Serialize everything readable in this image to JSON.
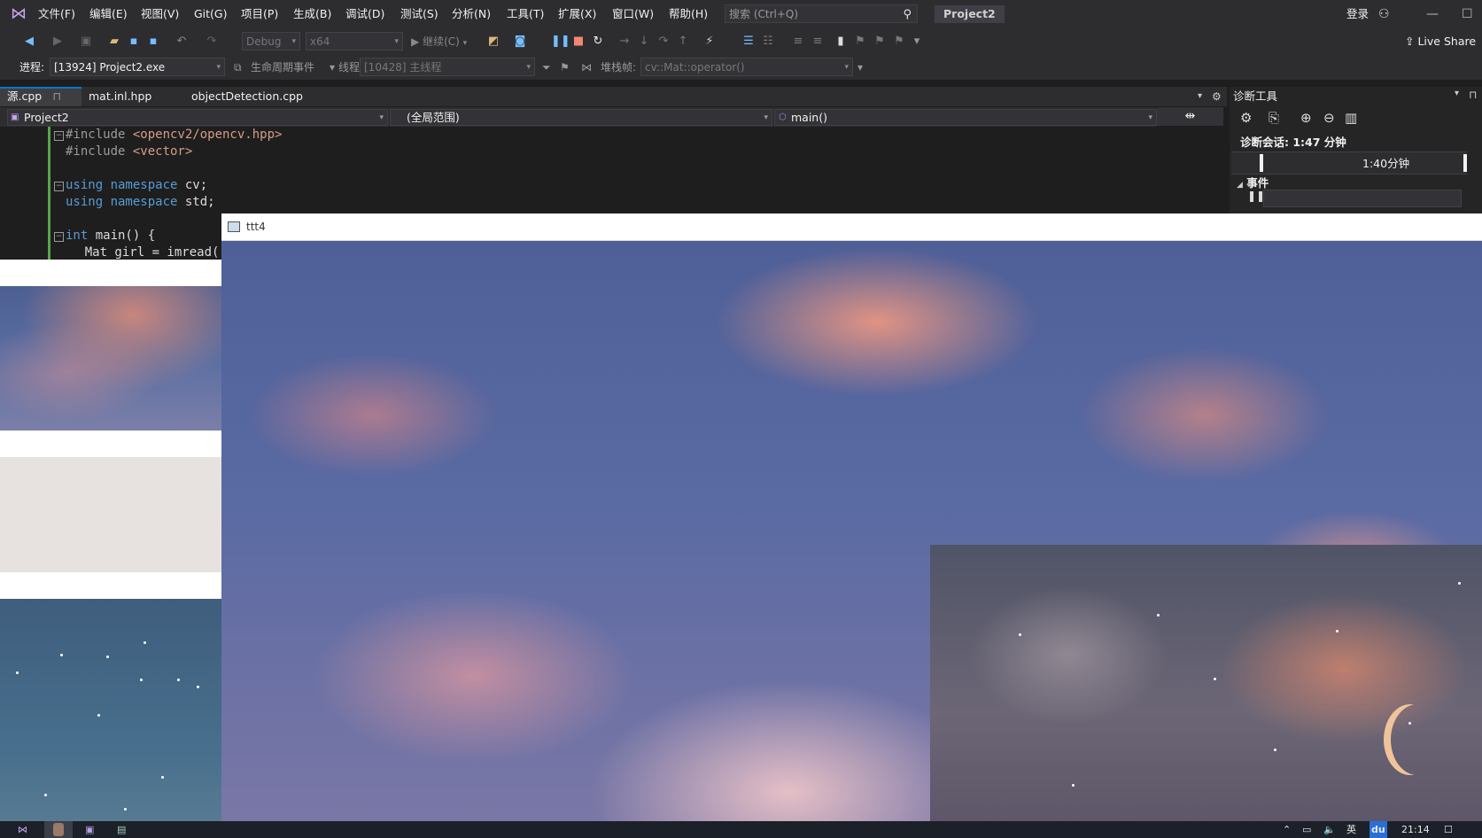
{
  "menu": [
    "文件(F)",
    "编辑(E)",
    "视图(V)",
    "Git(G)",
    "项目(P)",
    "生成(B)",
    "调试(D)",
    "测试(S)",
    "分析(N)",
    "工具(T)",
    "扩展(X)",
    "窗口(W)",
    "帮助(H)"
  ],
  "search": {
    "placeholder": "搜索 (Ctrl+Q)"
  },
  "project_name": "Project2",
  "signin": "登录",
  "live_share": "Live Share",
  "toolbar": {
    "config": "Debug",
    "platform": "x64",
    "continue": "继续(C)"
  },
  "debug_bar": {
    "process_label": "进程:",
    "process_value": "[13924] Project2.exe",
    "lifecycle_label": "生命周期事件",
    "thread_label": "线程:",
    "thread_value": "[10428] 主线程",
    "stack_label": "堆栈帧:",
    "stack_value": "cv::Mat::operator()"
  },
  "doc_tabs": [
    "源.cpp",
    "mat.inl.hpp",
    "objectDetection.cpp"
  ],
  "nav": {
    "project": "Project2",
    "scope": "(全局范围)",
    "member": "main()"
  },
  "code": [
    {
      "parts": [
        [
          "pp",
          "#include "
        ],
        [
          "inc",
          "<opencv2/opencv.hpp>"
        ]
      ]
    },
    {
      "parts": [
        [
          "pp",
          "#include "
        ],
        [
          "inc",
          "<vector>"
        ]
      ]
    },
    {
      "parts": []
    },
    {
      "parts": [
        [
          "kw",
          "using namespace "
        ],
        [
          "",
          "cv;"
        ]
      ]
    },
    {
      "parts": [
        [
          "kw",
          "using namespace "
        ],
        [
          "",
          "std;"
        ]
      ]
    },
    {
      "parts": []
    },
    {
      "parts": [
        [
          "kw",
          "int "
        ],
        [
          "",
          "main() {"
        ]
      ]
    },
    {
      "parts": [
        [
          "",
          "    Mat girl = imread("
        ]
      ]
    }
  ],
  "diag": {
    "title": "诊断工具",
    "session": "诊断会话: 1:47 分钟",
    "timeline": "1:40分钟",
    "events": "事件"
  },
  "image_window": {
    "title": "ttt4"
  },
  "taskbar": {
    "lang": "英",
    "time": "21:14"
  }
}
